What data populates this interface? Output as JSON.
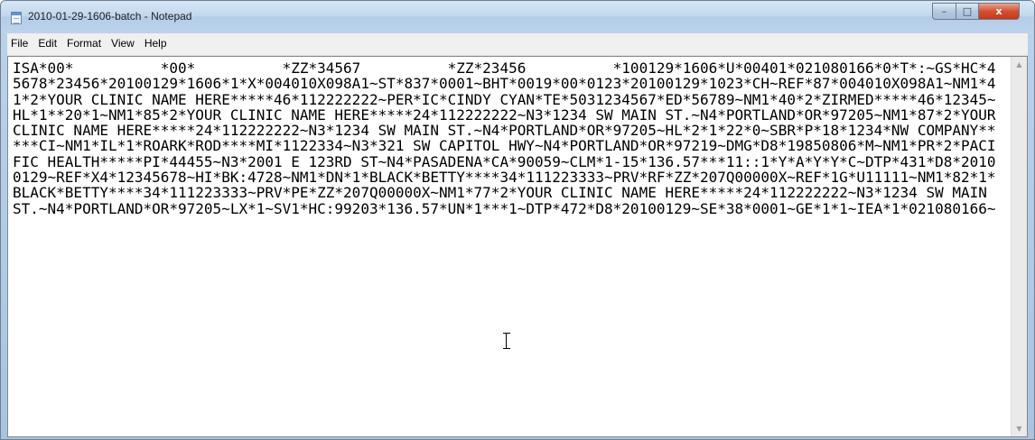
{
  "window": {
    "title": "2010-01-29-1606-batch - Notepad",
    "icon": "notepad-icon",
    "controls": {
      "minimize": "–",
      "maximize": "□",
      "close": "x"
    }
  },
  "menu": [
    "File",
    "Edit",
    "Format",
    "View",
    "Help"
  ],
  "document": {
    "text": "ISA*00*          *00*          *ZZ*34567          *ZZ*23456          *100129*1606*U*00401*021080166*0*T*:~GS*HC*45678*23456*20100129*1606*1*X*004010X098A1~ST*837*0001~BHT*0019*00*0123*20100129*1023*CH~REF*87*004010X098A1~NM1*41*2*YOUR CLINIC NAME HERE*****46*112222222~PER*IC*CINDY CYAN*TE*5031234567*ED*56789~NM1*40*2*ZIRMED*****46*12345~HL*1**20*1~NM1*85*2*YOUR CLINIC NAME HERE*****24*112222222~N3*1234 SW MAIN ST.~N4*PORTLAND*OR*97205~NM1*87*2*YOUR CLINIC NAME HERE*****24*112222222~N3*1234 SW MAIN ST.~N4*PORTLAND*OR*97205~HL*2*1*22*0~SBR*P*18*1234*NW COMPANY*****CI~NM1*IL*1*ROARK*ROD****MI*1122334~N3*321 SW CAPITOL HWY~N4*PORTLAND*OR*97219~DMG*D8*19850806*M~NM1*PR*2*PACIFIC HEALTH*****PI*44455~N3*2001 E 123RD ST~N4*PASADENA*CA*90059~CLM*1-15*136.57***11::1*Y*A*Y*Y*C~DTP*431*D8*20100129~REF*X4*12345678~HI*BK:4728~NM1*DN*1*BLACK*BETTY****34*111223333~PRV*RF*ZZ*207Q00000X~REF*1G*U11111~NM1*82*1*BLACK*BETTY****34*111223333~PRV*PE*ZZ*207Q00000X~NM1*77*2*YOUR CLINIC NAME HERE*****24*112222222~N3*1234 SW MAIN ST.~N4*PORTLAND*OR*97205~LX*1~SV1*HC:99203*136.57*UN*1***1~DTP*472*D8*20100129~SE*38*0001~GE*1*1~IEA*1*021080166~"
  },
  "scrollbar": {
    "up": "▲",
    "down": "▼"
  }
}
